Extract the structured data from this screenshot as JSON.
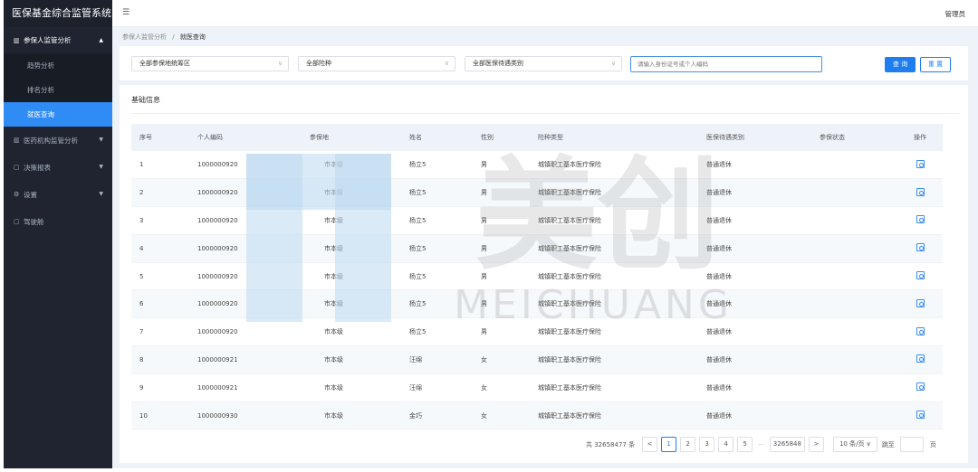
{
  "app": {
    "title": "医保基金综合监管系统",
    "user": "管理员"
  },
  "sidebar": {
    "items": [
      {
        "icon": "bar-chart-icon",
        "label": "参保人监管分析",
        "open": true
      },
      {
        "icon": "bar-chart-icon",
        "label": "医药机构监管分析"
      },
      {
        "icon": "report-icon",
        "label": "决策报表"
      },
      {
        "icon": "gear-icon",
        "label": "设置"
      },
      {
        "icon": "cockpit-icon",
        "label": "驾驶舱"
      }
    ],
    "sub_items": [
      {
        "label": "趋势分析"
      },
      {
        "label": "排名分析"
      },
      {
        "label": "就医查询"
      }
    ]
  },
  "breadcrumb": {
    "parent": "参保人监管分析",
    "sep": "/",
    "current": "就医查询"
  },
  "filters": {
    "region": "全部参保地统筹区",
    "insurance_type": "全部险种",
    "treatment_type": "全部医保待遇类别",
    "search_placeholder": "请输入身份证号或个人编码",
    "query_label": "查 询",
    "reset_label": "重 置"
  },
  "panel": {
    "title": "基础信息"
  },
  "table": {
    "headers": [
      "序号",
      "个人编码",
      "参保地",
      "姓名",
      "性别",
      "险种类型",
      "医保待遇类别",
      "参保状态",
      "操作"
    ],
    "rows": [
      [
        "1",
        "1000000920",
        "市本级",
        "杨立5",
        "男",
        "城镇职工基本医疗保险",
        "普通退休",
        ""
      ],
      [
        "2",
        "1000000920",
        "市本级",
        "杨立5",
        "男",
        "城镇职工基本医疗保险",
        "普通退休",
        ""
      ],
      [
        "3",
        "1000000920",
        "市本级",
        "杨立5",
        "男",
        "城镇职工基本医疗保险",
        "普通退休",
        ""
      ],
      [
        "4",
        "1000000920",
        "市本级",
        "杨立5",
        "男",
        "城镇职工基本医疗保险",
        "普通退休",
        ""
      ],
      [
        "5",
        "1000000920",
        "市本级",
        "杨立5",
        "男",
        "城镇职工基本医疗保险",
        "普通退休",
        ""
      ],
      [
        "6",
        "1000000920",
        "市本级",
        "杨立5",
        "男",
        "城镇职工基本医疗保险",
        "普通退休",
        ""
      ],
      [
        "7",
        "1000000920",
        "市本级",
        "杨立5",
        "男",
        "城镇职工基本医疗保险",
        "普通退休",
        ""
      ],
      [
        "8",
        "1000000921",
        "市本级",
        "汪绵",
        "女",
        "城镇职工基本医疗保险",
        "普通退休",
        ""
      ],
      [
        "9",
        "1000000921",
        "市本级",
        "汪绵",
        "女",
        "城镇职工基本医疗保险",
        "普通退休",
        ""
      ],
      [
        "10",
        "1000000930",
        "市本级",
        "金巧",
        "女",
        "城镇职工基本医疗保险",
        "普通退休",
        ""
      ]
    ]
  },
  "pagination": {
    "total": "共 32658477 条",
    "prev": "<",
    "pages": [
      "1",
      "2",
      "3",
      "4",
      "5"
    ],
    "dots": "···",
    "last": "3265848",
    "next": ">",
    "page_size": "10 条/页 ∨",
    "jump_label": "跳至",
    "page_unit": "页",
    "current_page": 1
  },
  "watermark": {
    "text": "MEICHUANG",
    "brand": "美创"
  },
  "colors": {
    "sidebar_bg": "#1f2430",
    "accent": "#1e7ef0",
    "active_menu": "#2f8cf5"
  }
}
